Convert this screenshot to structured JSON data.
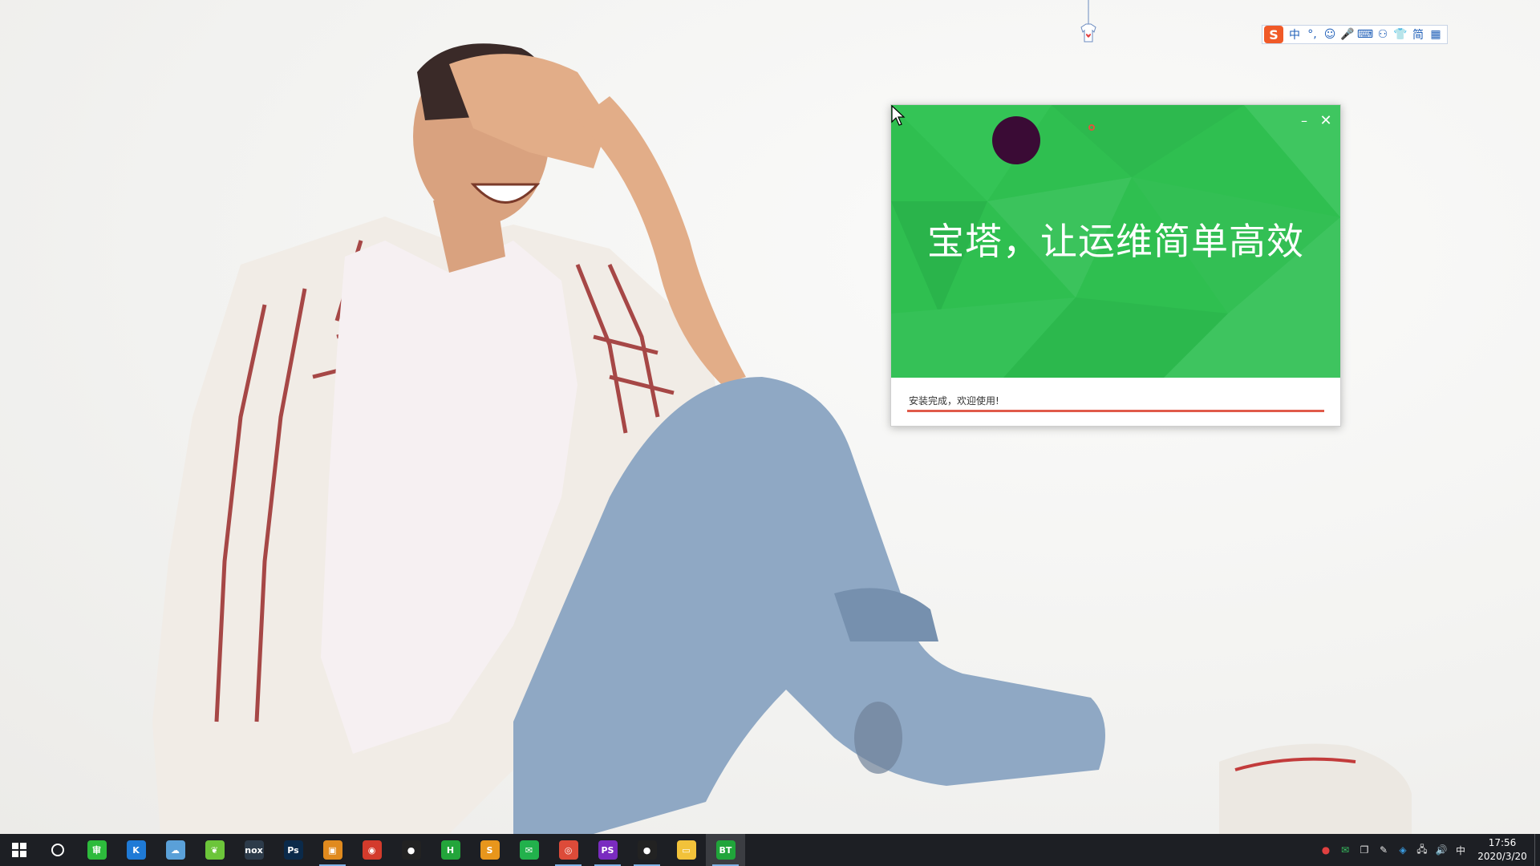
{
  "installer": {
    "slogan": "宝塔，让运维简单高效",
    "minimize_glyph": "–",
    "close_glyph": "✕",
    "status": "安装完成，欢迎使用!",
    "progress_percent": 100,
    "colors": {
      "banner": "#2fbf50",
      "progress": "#e05a4a"
    }
  },
  "ime_toolbar": {
    "logo": "S",
    "items": [
      {
        "icon": "chinese-mode",
        "glyph": "中"
      },
      {
        "icon": "punctuation",
        "glyph": "°,"
      },
      {
        "icon": "emoji-icon",
        "glyph": "☺"
      },
      {
        "icon": "microphone-icon",
        "glyph": "🎤"
      },
      {
        "icon": "keyboard-icon",
        "glyph": "⌨"
      },
      {
        "icon": "user-icon",
        "glyph": "⚇"
      },
      {
        "icon": "skin-icon",
        "glyph": "👕"
      },
      {
        "icon": "simplified",
        "glyph": "简"
      },
      {
        "icon": "grid-icon",
        "glyph": "▦"
      }
    ]
  },
  "taskbar": {
    "apps": [
      {
        "name": "app-green-shield",
        "label": "审",
        "color": "#2dbb3c",
        "running": false
      },
      {
        "name": "app-k",
        "label": "K",
        "color": "#1f7ad6",
        "running": false
      },
      {
        "name": "app-cloud",
        "label": "☁",
        "color": "#5aa0d8",
        "running": false
      },
      {
        "name": "app-leaf",
        "label": "❦",
        "color": "#6cc53a",
        "running": false
      },
      {
        "name": "app-nox",
        "label": "nox",
        "color": "#2d3b4a",
        "running": false
      },
      {
        "name": "app-photoshop",
        "label": "Ps",
        "color": "#0b2a4a",
        "running": false
      },
      {
        "name": "app-orange-windows",
        "label": "▣",
        "color": "#e08a1e",
        "running": true
      },
      {
        "name": "app-red-swirl",
        "label": "◉",
        "color": "#d33b2c",
        "running": false
      },
      {
        "name": "app-record",
        "label": "●",
        "color": "#222222",
        "running": false
      },
      {
        "name": "app-hbuilder",
        "label": "H",
        "color": "#23a53b",
        "running": false
      },
      {
        "name": "app-sublime",
        "label": "S",
        "color": "#e8961c",
        "running": false
      },
      {
        "name": "app-wechat",
        "label": "✉",
        "color": "#22b14c",
        "running": false
      },
      {
        "name": "app-chrome",
        "label": "◎",
        "color": "#dd4b39",
        "running": true
      },
      {
        "name": "app-phpstorm",
        "label": "PS",
        "color": "#7a2bc0",
        "running": true
      },
      {
        "name": "app-recorder",
        "label": "●",
        "color": "#222222",
        "running": true
      },
      {
        "name": "app-explorer",
        "label": "▭",
        "color": "#f2c23a",
        "running": false
      },
      {
        "name": "app-bt",
        "label": "BT",
        "color": "#20a53a",
        "running": true,
        "active": true
      }
    ],
    "tray": [
      {
        "icon": "record-tray-icon",
        "glyph": "●",
        "color": "#e04040"
      },
      {
        "icon": "wechat-tray-icon",
        "glyph": "✉",
        "color": "#38c060"
      },
      {
        "icon": "window-tray-icon",
        "glyph": "❐",
        "color": "#e8e8e8"
      },
      {
        "icon": "pen-tray-icon",
        "glyph": "✎",
        "color": "#e8e8e8"
      },
      {
        "icon": "security-tray-icon",
        "glyph": "◈",
        "color": "#3a9be0"
      },
      {
        "icon": "network-tray-icon",
        "glyph": "🖧",
        "color": "#e8e8e8"
      },
      {
        "icon": "volume-tray-icon",
        "glyph": "🔊",
        "color": "#e8e8e8"
      },
      {
        "icon": "ime-tray-icon",
        "glyph": "中",
        "color": "#e8e8e8"
      }
    ],
    "time": "17:56",
    "date": "2020/3/20"
  }
}
